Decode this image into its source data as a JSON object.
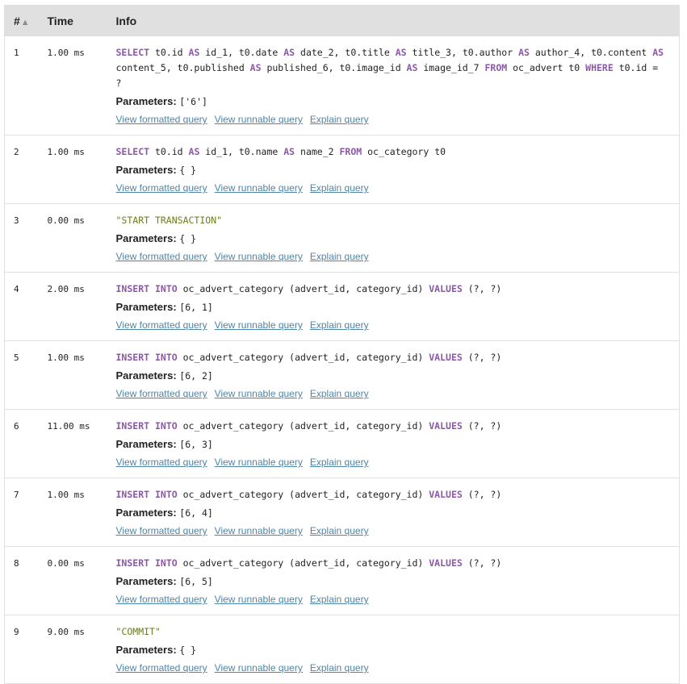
{
  "table": {
    "headers": {
      "num": "#",
      "time": "Time",
      "info": "Info"
    },
    "sort_icon": "sort-up-icon"
  },
  "links": {
    "formatted": "View formatted query",
    "runnable": "View runnable query",
    "explain": "Explain query"
  },
  "params_label": "Parameters:",
  "rows": [
    {
      "num": "1",
      "time": "1.00 ms",
      "tokens": [
        [
          "kw",
          "SELECT"
        ],
        [
          "t",
          " t0.id "
        ],
        [
          "kw",
          "AS"
        ],
        [
          "t",
          " id_1, t0.date "
        ],
        [
          "kw",
          "AS"
        ],
        [
          "t",
          " date_2, t0.title "
        ],
        [
          "kw",
          "AS"
        ],
        [
          "t",
          " title_3, t0.author "
        ],
        [
          "kw",
          "AS"
        ],
        [
          "t",
          " author_4, t0.content "
        ],
        [
          "kw",
          "AS"
        ],
        [
          "t",
          " content_5, t0.published "
        ],
        [
          "kw",
          "AS"
        ],
        [
          "t",
          " published_6, t0.image_id "
        ],
        [
          "kw",
          "AS"
        ],
        [
          "t",
          " image_id_7 "
        ],
        [
          "kw",
          "FROM"
        ],
        [
          "t",
          " oc_advert t0 "
        ],
        [
          "kw",
          "WHERE"
        ],
        [
          "t",
          " t0.id = ?"
        ]
      ],
      "params": "['6']"
    },
    {
      "num": "2",
      "time": "1.00 ms",
      "tokens": [
        [
          "kw",
          "SELECT"
        ],
        [
          "t",
          " t0.id "
        ],
        [
          "kw",
          "AS"
        ],
        [
          "t",
          " id_1, t0.name "
        ],
        [
          "kw",
          "AS"
        ],
        [
          "t",
          " name_2 "
        ],
        [
          "kw",
          "FROM"
        ],
        [
          "t",
          " oc_category t0"
        ]
      ],
      "params": "{ }"
    },
    {
      "num": "3",
      "time": "0.00 ms",
      "tokens": [
        [
          "str",
          "\"START TRANSACTION\""
        ]
      ],
      "params": "{ }"
    },
    {
      "num": "4",
      "time": "2.00 ms",
      "tokens": [
        [
          "kw",
          "INSERT"
        ],
        [
          "t",
          " "
        ],
        [
          "kw",
          "INTO"
        ],
        [
          "t",
          " oc_advert_category (advert_id, category_id) "
        ],
        [
          "kw",
          "VALUES"
        ],
        [
          "t",
          " (?, ?)"
        ]
      ],
      "params": "[6, 1]"
    },
    {
      "num": "5",
      "time": "1.00 ms",
      "tokens": [
        [
          "kw",
          "INSERT"
        ],
        [
          "t",
          " "
        ],
        [
          "kw",
          "INTO"
        ],
        [
          "t",
          " oc_advert_category (advert_id, category_id) "
        ],
        [
          "kw",
          "VALUES"
        ],
        [
          "t",
          " (?, ?)"
        ]
      ],
      "params": "[6, 2]"
    },
    {
      "num": "6",
      "time": "11.00 ms",
      "tokens": [
        [
          "kw",
          "INSERT"
        ],
        [
          "t",
          " "
        ],
        [
          "kw",
          "INTO"
        ],
        [
          "t",
          " oc_advert_category (advert_id, category_id) "
        ],
        [
          "kw",
          "VALUES"
        ],
        [
          "t",
          " (?, ?)"
        ]
      ],
      "params": "[6, 3]"
    },
    {
      "num": "7",
      "time": "1.00 ms",
      "tokens": [
        [
          "kw",
          "INSERT"
        ],
        [
          "t",
          " "
        ],
        [
          "kw",
          "INTO"
        ],
        [
          "t",
          " oc_advert_category (advert_id, category_id) "
        ],
        [
          "kw",
          "VALUES"
        ],
        [
          "t",
          " (?, ?)"
        ]
      ],
      "params": "[6, 4]"
    },
    {
      "num": "8",
      "time": "0.00 ms",
      "tokens": [
        [
          "kw",
          "INSERT"
        ],
        [
          "t",
          " "
        ],
        [
          "kw",
          "INTO"
        ],
        [
          "t",
          " oc_advert_category (advert_id, category_id) "
        ],
        [
          "kw",
          "VALUES"
        ],
        [
          "t",
          " (?, ?)"
        ]
      ],
      "params": "[6, 5]"
    },
    {
      "num": "9",
      "time": "9.00 ms",
      "tokens": [
        [
          "str",
          "\"COMMIT\""
        ]
      ],
      "params": "{ }"
    }
  ]
}
